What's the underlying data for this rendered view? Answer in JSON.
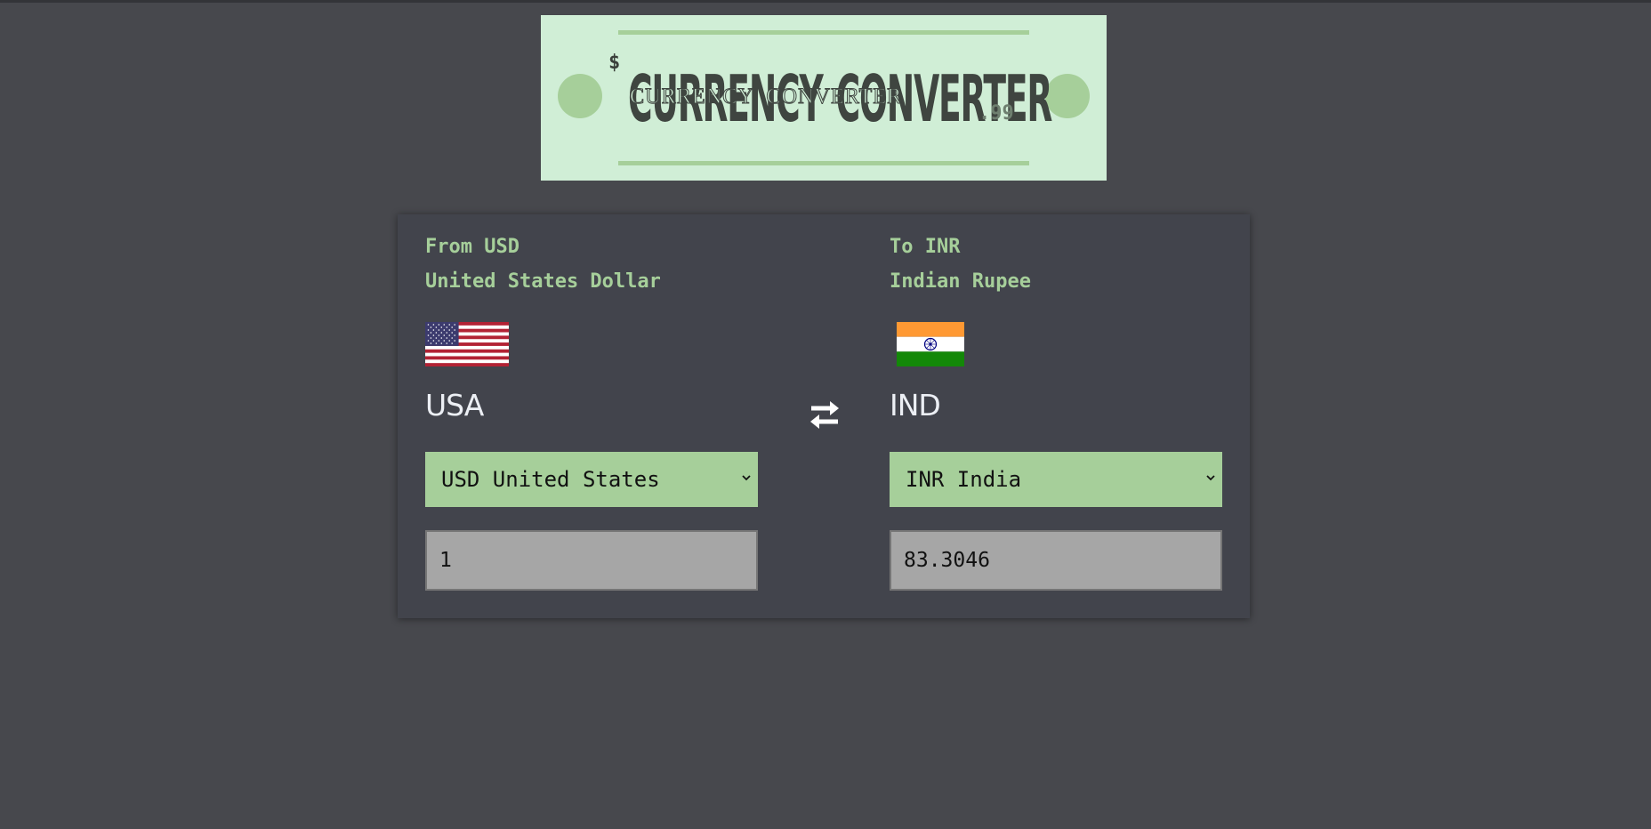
{
  "banner": {
    "currency_symbol": "$",
    "title_word1": "CURRENCY",
    "title_word2": "CONVERTER",
    "cents": ".99"
  },
  "from": {
    "code_line": "From USD",
    "name_line": "United States Dollar",
    "country": "USA",
    "select_value": "USD United States",
    "amount": "1",
    "flag_icon": "us-flag-icon"
  },
  "to": {
    "code_line": "To INR",
    "name_line": "Indian Rupee",
    "country": "IND",
    "select_value": "INR India",
    "amount": "83.3046",
    "flag_icon": "india-flag-icon"
  },
  "swap_icon": "swap-arrows-icon",
  "colors": {
    "page_bg": "#47484d",
    "card_bg": "#42444c",
    "accent_green": "#a6cf9a",
    "banner_bg": "#d0eed6",
    "input_bg": "#a6a6a6"
  }
}
